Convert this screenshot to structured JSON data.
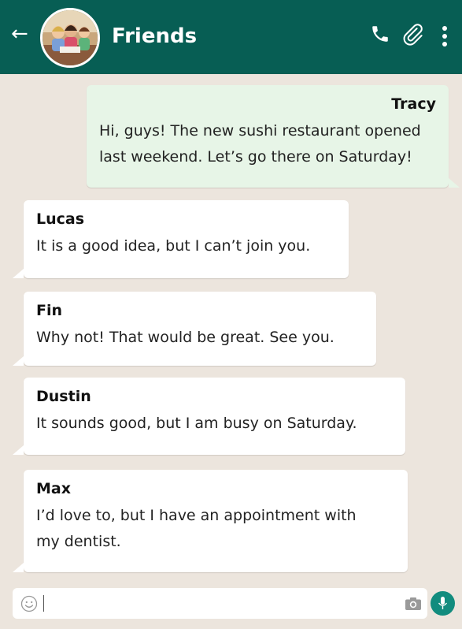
{
  "header": {
    "title": "Friends",
    "icons": [
      "back-arrow-icon",
      "call-icon",
      "paperclip-icon",
      "more-vert-icon"
    ]
  },
  "messages": [
    {
      "sender": "Tracy",
      "direction": "outgoing",
      "lines": [
        "Hi, guys! The new sushi restaurant opened",
        "last weekend. Let’s go there on Saturday!"
      ]
    },
    {
      "sender": "Lucas",
      "direction": "incoming",
      "lines": [
        "It is a good idea, but I can’t join you."
      ]
    },
    {
      "sender": "Fin",
      "direction": "incoming",
      "lines": [
        "Why not! That would be great. See you."
      ]
    },
    {
      "sender": "Dustin",
      "direction": "incoming",
      "lines": [
        "It sounds good, but I am busy on Saturday."
      ]
    },
    {
      "sender": "Max",
      "direction": "incoming",
      "lines": [
        "I’d love to, but I have an appointment with",
        "my dentist."
      ]
    }
  ],
  "composer": {
    "value": "",
    "icons": [
      "emoji-icon",
      "camera-icon",
      "mic-icon"
    ]
  },
  "colors": {
    "header": "#075e54",
    "background": "#ece5dd",
    "outgoing_bubble": "#e7f5e7",
    "incoming_bubble": "#ffffff",
    "mic_button": "#128c7e"
  }
}
